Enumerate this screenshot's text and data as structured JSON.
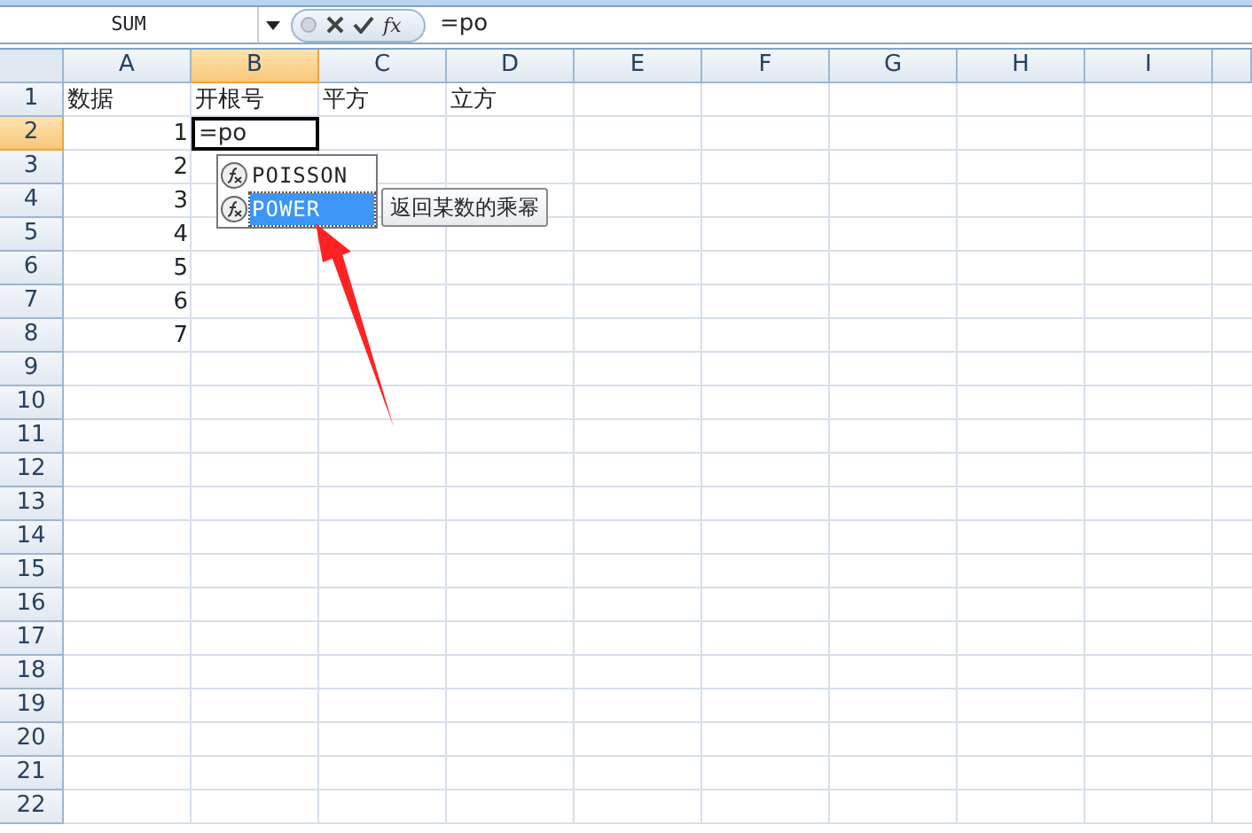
{
  "formula_bar": {
    "name_box": "SUM",
    "fx": "fx",
    "formula": "=po"
  },
  "columns": [
    {
      "label": "A",
      "selected": false
    },
    {
      "label": "B",
      "selected": true
    },
    {
      "label": "C",
      "selected": false
    },
    {
      "label": "D",
      "selected": false
    },
    {
      "label": "E",
      "selected": false
    },
    {
      "label": "F",
      "selected": false
    },
    {
      "label": "G",
      "selected": false
    },
    {
      "label": "H",
      "selected": false
    },
    {
      "label": "I",
      "selected": false
    }
  ],
  "rows": [
    {
      "label": "1",
      "selected": false,
      "cells": [
        {
          "text": "数据",
          "kind": "text",
          "active": false
        },
        {
          "text": "开根号",
          "kind": "text",
          "active": false
        },
        {
          "text": "平方",
          "kind": "text",
          "active": false
        },
        {
          "text": "立方",
          "kind": "text",
          "active": false
        }
      ]
    },
    {
      "label": "2",
      "selected": true,
      "cells": [
        {
          "text": "1",
          "kind": "number",
          "active": false
        },
        {
          "text": "=po",
          "kind": "text",
          "active": true
        }
      ]
    },
    {
      "label": "3",
      "selected": false,
      "cells": [
        {
          "text": "2",
          "kind": "number",
          "active": false
        }
      ]
    },
    {
      "label": "4",
      "selected": false,
      "cells": [
        {
          "text": "3",
          "kind": "number",
          "active": false
        }
      ]
    },
    {
      "label": "5",
      "selected": false,
      "cells": [
        {
          "text": "4",
          "kind": "number",
          "active": false
        }
      ]
    },
    {
      "label": "6",
      "selected": false,
      "cells": [
        {
          "text": "5",
          "kind": "number",
          "active": false
        }
      ]
    },
    {
      "label": "7",
      "selected": false,
      "cells": [
        {
          "text": "6",
          "kind": "number",
          "active": false
        }
      ]
    },
    {
      "label": "8",
      "selected": false,
      "cells": [
        {
          "text": "7",
          "kind": "number",
          "active": false
        }
      ]
    },
    {
      "label": "9",
      "selected": false
    },
    {
      "label": "10",
      "selected": false
    },
    {
      "label": "11",
      "selected": false
    },
    {
      "label": "12",
      "selected": false
    },
    {
      "label": "13",
      "selected": false
    },
    {
      "label": "14",
      "selected": false
    },
    {
      "label": "15",
      "selected": false
    },
    {
      "label": "16",
      "selected": false
    },
    {
      "label": "17",
      "selected": false
    },
    {
      "label": "18",
      "selected": false
    },
    {
      "label": "19",
      "selected": false
    },
    {
      "label": "20",
      "selected": false
    },
    {
      "label": "21",
      "selected": false
    },
    {
      "label": "22",
      "selected": false
    }
  ],
  "autocomplete": {
    "items": [
      {
        "label": "POISSON",
        "selected": false
      },
      {
        "label": "POWER",
        "selected": true
      }
    ],
    "tooltip": "返回某数的乘幂"
  }
}
